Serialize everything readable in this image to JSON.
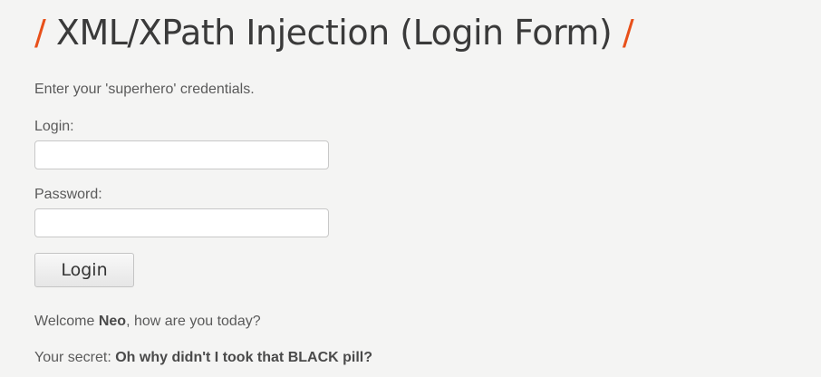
{
  "header": {
    "slash_left": "/",
    "title": "XML/XPath Injection (Login Form)",
    "slash_right": "/",
    "accent_color": "#e8501a"
  },
  "form": {
    "intro": "Enter your 'superhero' credentials.",
    "login_label": "Login:",
    "login_value": "",
    "password_label": "Password:",
    "password_value": "",
    "submit_label": "Login"
  },
  "result": {
    "welcome_prefix": "Welcome ",
    "user_name": "Neo",
    "welcome_suffix": ", how are you today?",
    "secret_prefix": "Your secret: ",
    "secret": "Oh why didn't I took that BLACK pill?"
  }
}
